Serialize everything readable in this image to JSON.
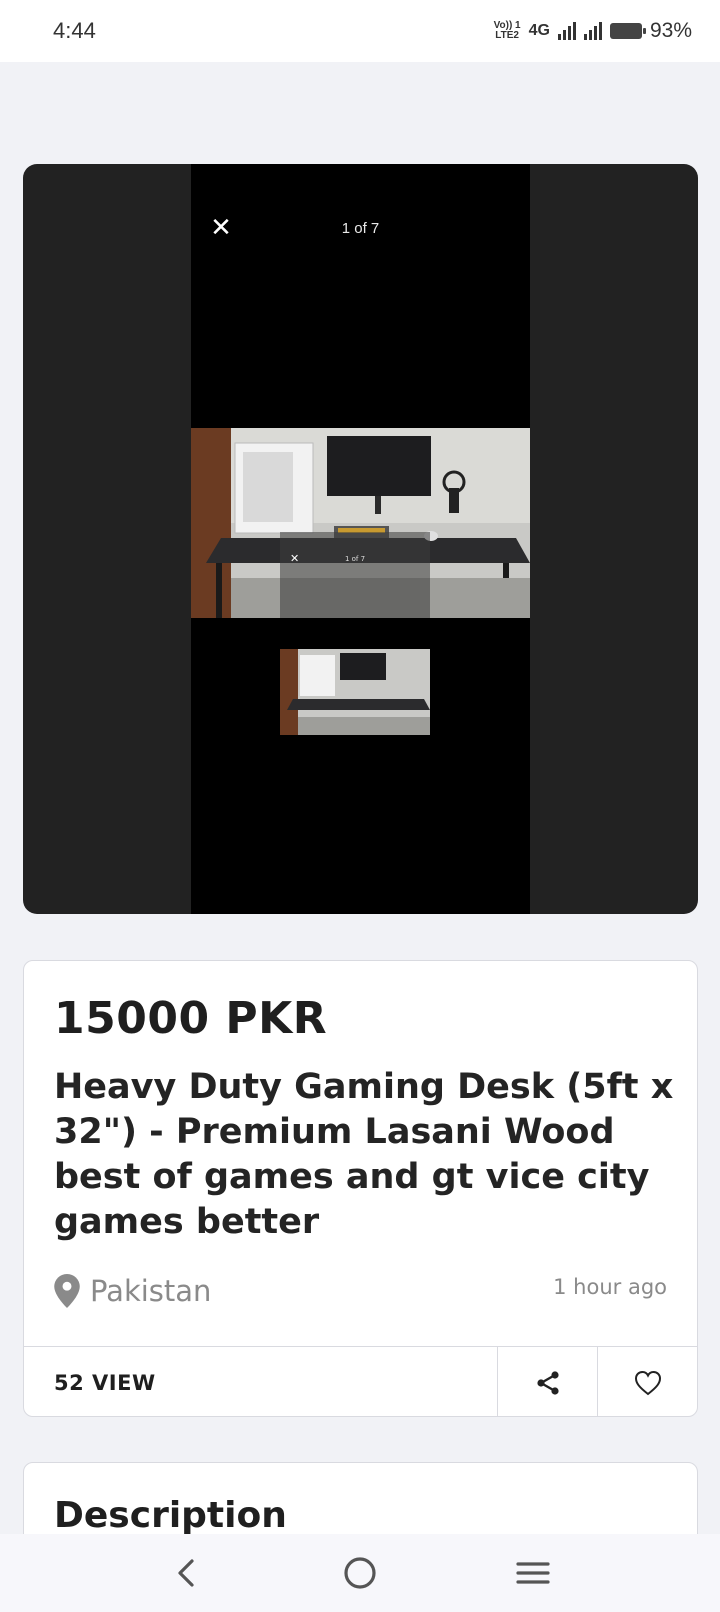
{
  "status_bar": {
    "time": "4:44",
    "volte": "Vo)) 1",
    "lte": "LTE2",
    "network": "4G",
    "battery": "93%"
  },
  "partial_text": "Wood",
  "gallery": {
    "counter": "1 of 7",
    "overlay_counter": "1 of 7"
  },
  "listing": {
    "price": "15000 PKR",
    "title": "Heavy Duty Gaming Desk (5ft x 32\") - Premium Lasani Wood best of games and gt vice city games better",
    "location": "Pakistan",
    "posted": "1 hour ago",
    "views": "52 VIEW"
  },
  "description": {
    "heading": "Description"
  },
  "colors": {
    "gallery_bg": "#222222",
    "page_bg": "#f1f2f6",
    "muted_text": "#8a8a8a"
  }
}
